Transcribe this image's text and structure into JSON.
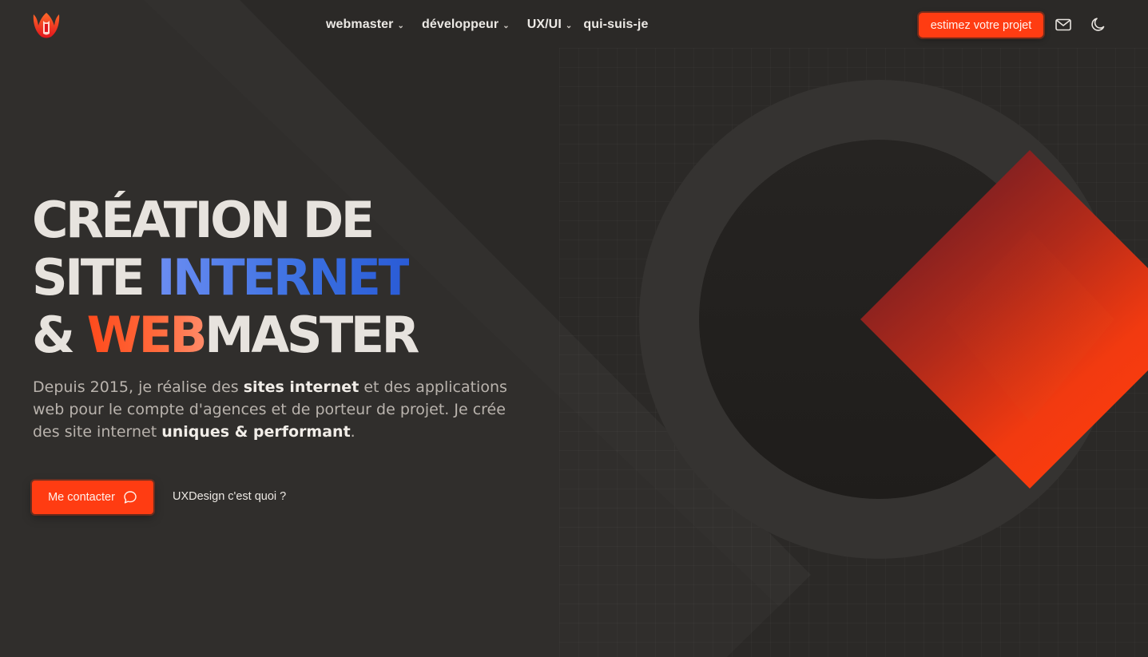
{
  "header": {
    "logo_icon": "w-flame-logo-icon",
    "nav": [
      {
        "label": "webmaster",
        "has_dropdown": true
      },
      {
        "label": "développeur",
        "has_dropdown": true
      },
      {
        "label": "UX/UI",
        "has_dropdown": true
      },
      {
        "label": "qui-suis-je",
        "has_dropdown": false
      }
    ],
    "cta_label": "estimez votre projet",
    "mail_icon": "mail-icon",
    "theme_icon": "moon-icon"
  },
  "hero": {
    "title": {
      "line1": "CRÉATION DE",
      "line2_plain": "SITE ",
      "line2_highlight": "INTERNET",
      "line3_prefix": "& ",
      "line3_highlight": "WEB",
      "line3_rest": "MASTER"
    },
    "text": {
      "p1": "Depuis 2015, je réalise des ",
      "b1": "sites internet",
      "p2": " et des applications web pour le compte d'agences et de porteur de projet. Je crée des site internet ",
      "b2": "uniques & performant",
      "p3": "."
    },
    "contact_button": "Me contacter",
    "contact_icon": "chat-bubble-icon",
    "ux_link": "UXDesign c'est quoi ?"
  },
  "colors": {
    "background": "#2b2927",
    "accent": "#ff3c12",
    "blue": "#3a6fe0",
    "text": "#e7e3de"
  }
}
